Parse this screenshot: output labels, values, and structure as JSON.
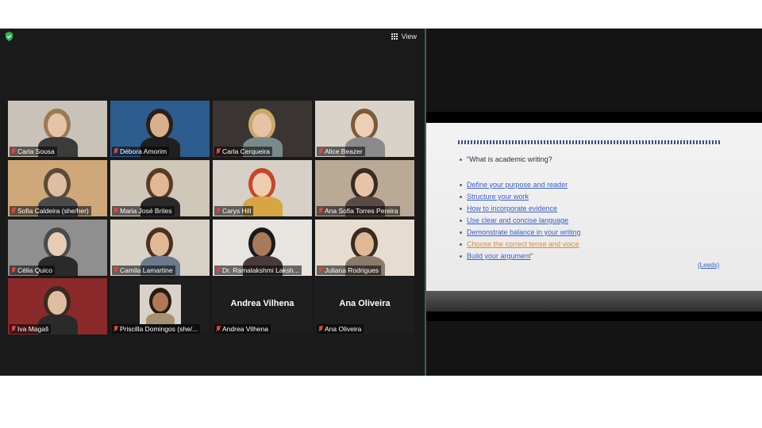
{
  "toolbar": {
    "view_label": "View"
  },
  "participants": [
    {
      "name": "Carla Sousa",
      "bg": "#c9c2b8",
      "hair": "#9a7a52",
      "shirt": "#3b3b3b",
      "skin": "#e6c3a6"
    },
    {
      "name": "Débora Amorim",
      "bg": "#2d5c8e",
      "hair": "#2a1f1a",
      "shirt": "#1f1f1f",
      "skin": "#d8b08c"
    },
    {
      "name": "Carla Cerqueira",
      "bg": "#3a3533",
      "hair": "#c9a86a",
      "shirt": "#7a8a8a",
      "skin": "#e6c3a6"
    },
    {
      "name": "Alice Beazer",
      "bg": "#d9d2c8",
      "hair": "#7a5a3a",
      "shirt": "#8a8a8a",
      "skin": "#eccfb5"
    },
    {
      "name": "Sofia Caldeira (she/her)",
      "bg": "#cfa87a",
      "hair": "#5a4a3a",
      "shirt": "#4a4a4a",
      "skin": "#e0bca0"
    },
    {
      "name": "Maria José Brites",
      "bg": "#cfc7b8",
      "hair": "#5a3a26",
      "shirt": "#2a2a2a",
      "skin": "#e0b896",
      "active": true
    },
    {
      "name": "Carys Hill",
      "bg": "#d6d0c6",
      "hair": "#c8452a",
      "shirt": "#d8a640",
      "skin": "#f0ccb0"
    },
    {
      "name": "Ana Sofia Torres Pereira",
      "bg": "#b9a995",
      "hair": "#3a2a22",
      "shirt": "#5a4a44",
      "skin": "#e6c4a8"
    },
    {
      "name": "Célia Quico",
      "bg": "#8f8f8f",
      "hair": "#4a4a4a",
      "shirt": "#2a2a2a",
      "skin": "#e6cdb8"
    },
    {
      "name": "Camila Lamartine",
      "bg": "#d8d2c6",
      "hair": "#4a3022",
      "shirt": "#6a7a8a",
      "skin": "#e0b896"
    },
    {
      "name": "Dr. Ramalakshmi Laksh...",
      "bg": "#e8e4e0",
      "hair": "#1a1a1a",
      "shirt": "#4a3a3a",
      "skin": "#a67a5a"
    },
    {
      "name": "Juliana Rodrigues",
      "bg": "#e6ddd0",
      "hair": "#3a2a22",
      "shirt": "#8a7a6a",
      "skin": "#e0b896"
    },
    {
      "name": "Iva Magaš",
      "bg": "#8a2a2a",
      "hair": "#3a2a22",
      "shirt": "#2a2a2a",
      "skin": "#e0bca0"
    },
    {
      "name": "Priscilla Domingos (she/...",
      "bg": "#1e1e1e",
      "photo": true,
      "hair": "#2a1a14",
      "shirt": "#a89070",
      "skin": "#b07a58"
    },
    {
      "name": "Andrea Vilhena",
      "bg": "#1e1e1e",
      "placeholder": "Andrea Vilhena"
    },
    {
      "name": "Ana Oliveira",
      "bg": "#1e1e1e",
      "placeholder": "Ana Oliveira"
    }
  ],
  "slide": {
    "question": "\"What is academic writing?",
    "items": [
      {
        "text": "Define your purpose and reader",
        "color": "blue"
      },
      {
        "text": "Structure your work",
        "color": "blue"
      },
      {
        "text": "How to incorporate evidence",
        "color": "blue"
      },
      {
        "text": "Use clear and concise language",
        "color": "blue"
      },
      {
        "text": "Demonstrate balance in your writing",
        "color": "blue"
      },
      {
        "text": "Choose the correct tense and voice",
        "color": "orange"
      },
      {
        "text": "Build your argument",
        "color": "blue",
        "suffix": "\""
      }
    ],
    "source": "(Leeds)"
  },
  "colors": {
    "accent_active": "#e8e070",
    "divider": "#2f6b47",
    "mic_muted": "#e04545",
    "link": "#3a5fcd",
    "link_orange": "#e08a2e"
  }
}
